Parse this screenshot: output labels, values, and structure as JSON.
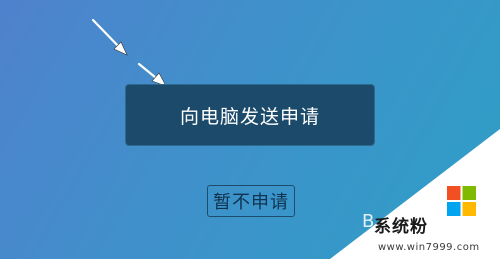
{
  "buttons": {
    "send_request": "向电脑发送申请",
    "not_now": "暂不申请"
  },
  "watermark": {
    "partial_letter": "B",
    "title": "系统粉",
    "url": "www.win7999.com",
    "logo_colors": [
      "#f25022",
      "#7fba00",
      "#00a4ef",
      "#ffb900"
    ]
  },
  "icons": [
    "pointer-arrow-icon",
    "windows-logo-icon"
  ]
}
